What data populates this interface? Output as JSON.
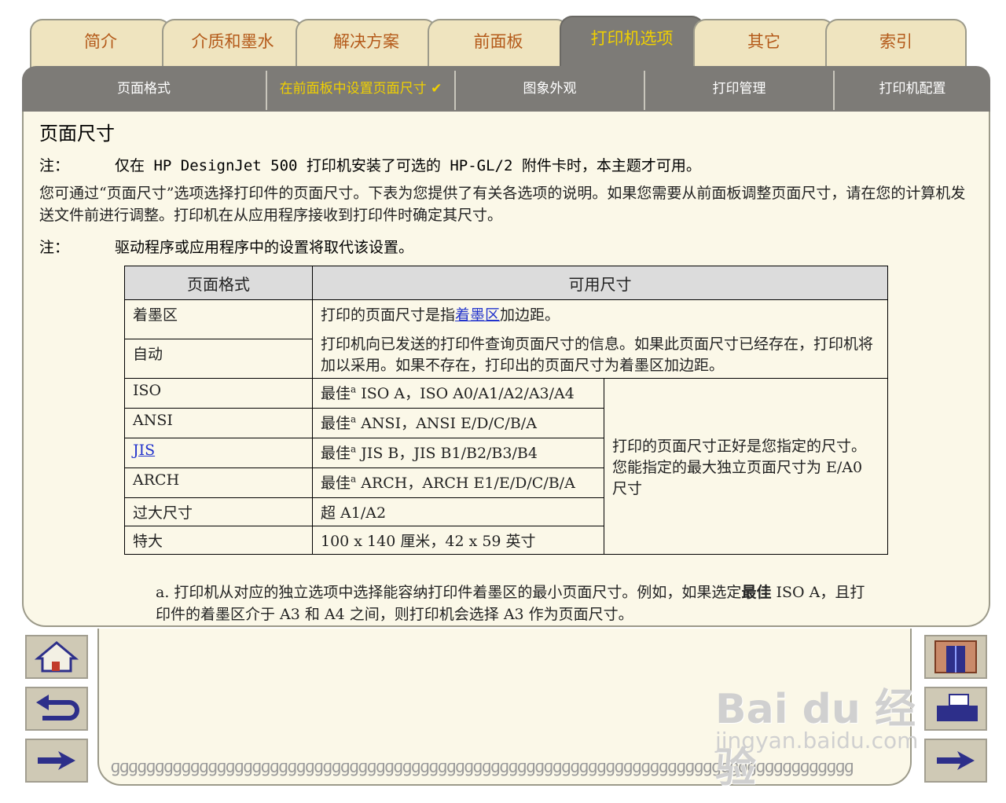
{
  "tabs": [
    "简介",
    "介质和墨水",
    "解决方案",
    "前面板",
    "打印机选项",
    "其它",
    "索引"
  ],
  "active_tab": "打印机选项",
  "subnav": [
    "页面格式",
    "在前面板中设置页面尺寸 ✔",
    "图象外观",
    "打印管理",
    "打印机配置"
  ],
  "page": {
    "title": "页面尺寸",
    "note1_label": "注：",
    "note1_text": "仅在 HP DesignJet 500 打印机安装了可选的 HP-GL/2 附件卡时，本主题才可用。",
    "paragraph": "您可通过“页面尺寸”选项选择打印件的页面尺寸。下表为您提供了有关各选项的说明。如果您需要从前面板调整页面尺寸，请在您的计算机发送文件前进行调整。打印机在从应用程序接收到打印件时确定其尺寸。",
    "note2_label": "注：",
    "note2_text": "驱动程序或应用程序中的设置将取代该设置。"
  },
  "table": {
    "headers": [
      "页面格式",
      "可用尺寸"
    ],
    "row_inked": {
      "format": "着墨区",
      "pre": "打印的页面尺寸是指",
      "link": "着墨区",
      "post": "加边距。"
    },
    "row_auto": {
      "format": "自动",
      "desc": "打印机向已发送的打印件查询页面尺寸的信息。如果此页面尺寸已经存在，打印机将加以采用。如果不存在，打印出的页面尺寸为着墨区加边距。"
    },
    "rows": [
      {
        "format": "ISO",
        "pre": "最佳",
        "sup": "a",
        "post": " ISO A，ISO A0/A1/A2/A3/A4"
      },
      {
        "format": "ANSI",
        "pre": "最佳",
        "sup": "a",
        "post": " ANSI，ANSI E/D/C/B/A"
      },
      {
        "format": "JIS",
        "pre": "最佳",
        "sup": "a",
        "post": " JIS B，JIS B1/B2/B3/B4"
      },
      {
        "format": "ARCH",
        "pre": "最佳",
        "sup": "a",
        "post": " ARCH，ARCH E1/E/D/C/B/A"
      },
      {
        "format": "过大尺寸",
        "text": "超 A1/A2"
      },
      {
        "format": "特大",
        "text": "100 x 140 厘米，42 x 59 英寸"
      }
    ],
    "merged_note": "打印的页面尺寸正好是您指定的尺寸。您能指定的最大独立页面尺寸为 E/A0 尺寸"
  },
  "footnote": {
    "marker": "a.",
    "text1": "打印机从对应的独立选项中选择能容纳打印件着墨区的最小页面尺寸。例如，如果选定",
    "bold": "最佳",
    "text2": " ISO A，且打印件的着墨区介于 A3 和 A4 之间，则打印机会选择 A3 作为页面尺寸。"
  },
  "watermark": {
    "logo": "Bai du 经验",
    "url": "jingyan.baidu.com"
  },
  "icons": [
    "home-icon",
    "back-icon",
    "next-page-icon",
    "index-door-icon",
    "printer-icon",
    "forward-icon"
  ]
}
